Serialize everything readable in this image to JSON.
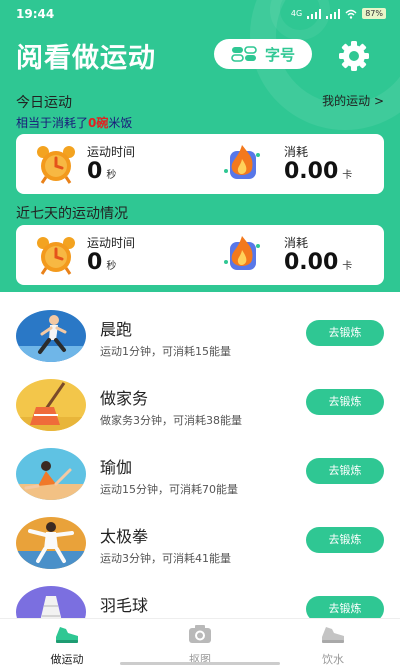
{
  "status_bar": {
    "time": "19:44",
    "network": "4G",
    "battery": "87%"
  },
  "header": {
    "title": "阅看做运动",
    "font_button_label": "字号"
  },
  "today": {
    "section_title": "今日运动",
    "my_sports_link": "我的运动 >",
    "note_prefix": "相当于消耗了",
    "note_value": "0碗",
    "note_suffix": "米饭",
    "duration_label": "运动时间",
    "duration_value": "0",
    "duration_unit": "秒",
    "calorie_label": "消耗",
    "calorie_value": "0.00",
    "calorie_unit": "卡"
  },
  "week": {
    "section_title": "近七天的运动情况",
    "duration_label": "运动时间",
    "duration_value": "0",
    "duration_unit": "秒",
    "calorie_label": "消耗",
    "calorie_value": "0.00",
    "calorie_unit": "卡"
  },
  "activities": [
    {
      "name": "晨跑",
      "desc": "运动1分钟，可消耗15能量",
      "button": "去锻炼"
    },
    {
      "name": "做家务",
      "desc": "做家务3分钟，可消耗38能量",
      "button": "去锻炼"
    },
    {
      "name": "瑜伽",
      "desc": "运动15分钟，可消耗70能量",
      "button": "去锻炼"
    },
    {
      "name": "太极拳",
      "desc": "运动3分钟，可消耗41能量",
      "button": "去锻炼"
    },
    {
      "name": "羽毛球",
      "desc": "",
      "button": "去锻炼"
    }
  ],
  "tabs": [
    {
      "label": "做运动",
      "icon": "sneaker-icon"
    },
    {
      "label": "抠图",
      "icon": "camera-icon"
    },
    {
      "label": "饮水",
      "icon": "shoe-icon"
    }
  ],
  "colors": {
    "brand": "#2fc793",
    "accent_red": "#e22020"
  }
}
